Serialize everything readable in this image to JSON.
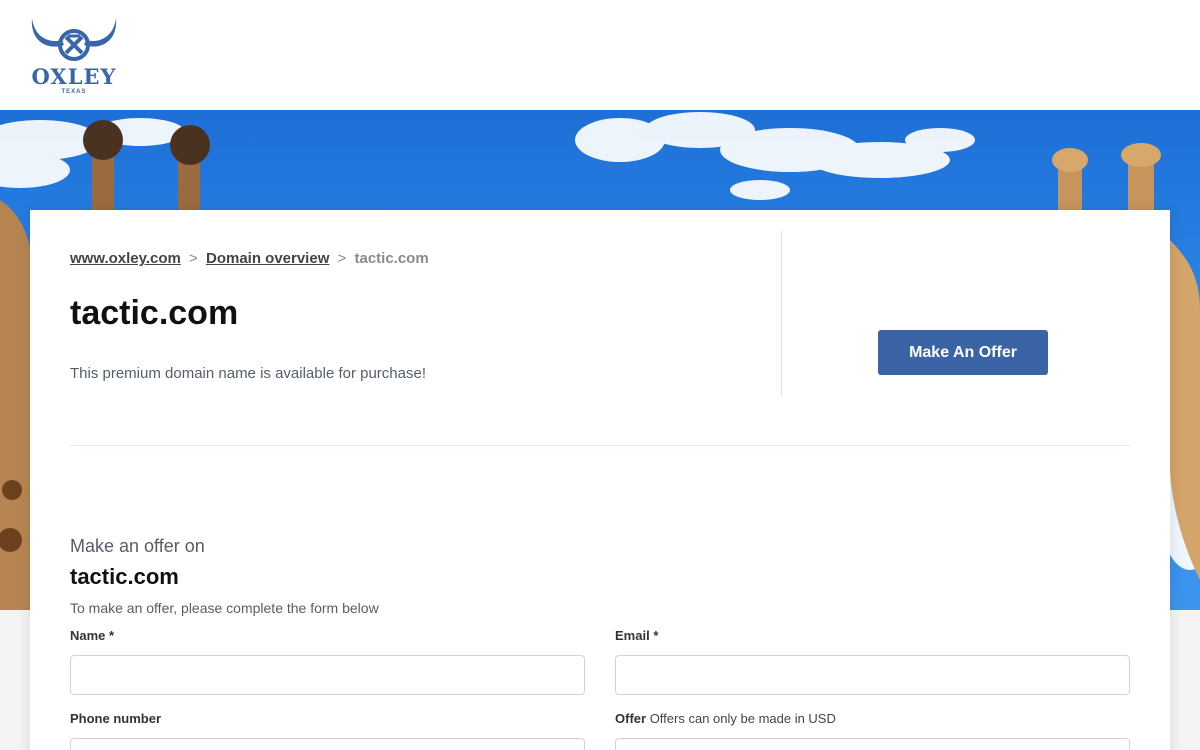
{
  "brand": {
    "name": "OXLEY",
    "tagline": "TEXAS",
    "color": "#3a66a8"
  },
  "breadcrumb": {
    "home": "www.oxley.com",
    "sep1": ">",
    "overview": "Domain overview",
    "sep2": ">",
    "current": "tactic.com"
  },
  "domain": {
    "title": "tactic.com",
    "subtitle": "This premium domain name is available for purchase!"
  },
  "cta": {
    "label": "Make An Offer",
    "color": "#3a64a6"
  },
  "form": {
    "intro": "Make an offer on",
    "domain": "tactic.com",
    "note": "To make an offer, please complete the form below",
    "fields": {
      "name": {
        "label": "Name",
        "required": "*",
        "value": "",
        "placeholder": ""
      },
      "email": {
        "label": "Email",
        "required": "*",
        "value": "",
        "placeholder": ""
      },
      "phone": {
        "label": "Phone number",
        "value": "",
        "placeholder": ""
      },
      "offer": {
        "label": "Offer",
        "hint": "Offers can only be made in USD",
        "value": "",
        "placeholder": ""
      }
    }
  },
  "hero": {
    "sky_color": "#2b86e8"
  }
}
